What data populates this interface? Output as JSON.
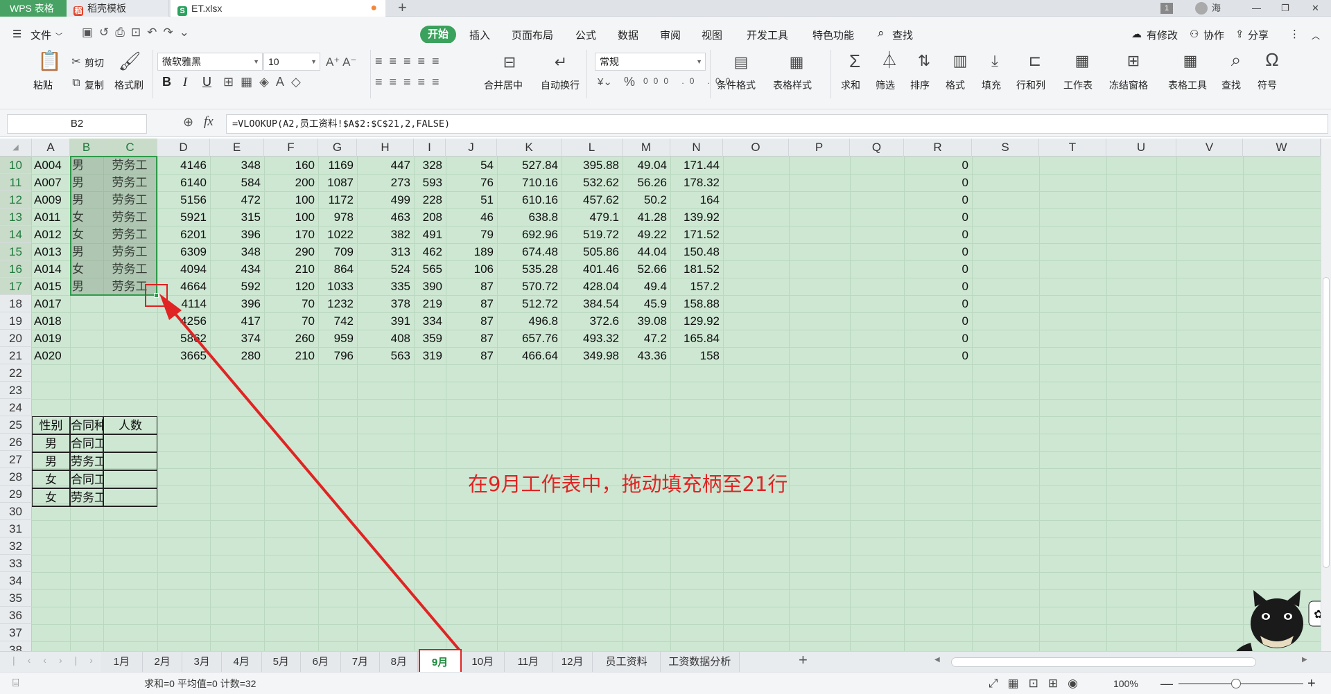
{
  "titlebar": {
    "app_tab": "WPS 表格",
    "docer_tab": "稻壳模板",
    "file_tab": "ET.xlsx",
    "new_tab": "+",
    "badge": "1",
    "user": "海"
  },
  "menu": {
    "file": "文件",
    "items": [
      "开始",
      "插入",
      "页面布局",
      "公式",
      "数据",
      "审阅",
      "视图",
      "开发工具",
      "特色功能"
    ],
    "search": "查找",
    "right": [
      "有修改",
      "协作",
      "分享"
    ]
  },
  "ribbon": {
    "paste": "粘贴",
    "cut": "剪切",
    "copy": "复制",
    "format_painter": "格式刷",
    "font_name": "微软雅黑",
    "font_size": "10",
    "bold": "B",
    "italic": "I",
    "underline": "U",
    "merge": "合并居中",
    "wrap": "自动换行",
    "number_format": "常规",
    "percent": "%",
    "cond_format": "条件格式",
    "table_style": "表格样式",
    "sum": "求和",
    "filter": "筛选",
    "sort": "排序",
    "format": "格式",
    "fill": "填充",
    "rowcol": "行和列",
    "sheet": "工作表",
    "freeze": "冻结窗格",
    "table_tools": "表格工具",
    "find": "查找",
    "symbol": "符号"
  },
  "formula_bar": {
    "name_box": "B2",
    "fx": "fx",
    "formula": "=VLOOKUP(A2,员工资料!$A$2:$C$21,2,FALSE)"
  },
  "grid": {
    "columns": [
      "A",
      "B",
      "C",
      "D",
      "E",
      "F",
      "G",
      "H",
      "I",
      "J",
      "K",
      "L",
      "M",
      "N",
      "O",
      "P",
      "Q",
      "R",
      "S",
      "T",
      "U",
      "V",
      "W"
    ],
    "row_numbers": [
      10,
      11,
      12,
      13,
      14,
      15,
      16,
      17,
      18,
      19,
      20,
      21,
      22,
      23,
      24,
      25,
      26,
      27,
      28,
      29,
      30,
      31,
      32,
      33,
      34,
      35,
      36,
      37,
      38
    ],
    "rows": [
      [
        "A004",
        "男",
        "劳务工",
        "4146",
        "348",
        "160",
        "1169",
        "447",
        "328",
        "54",
        "527.84",
        "395.88",
        "49.04",
        "171.44",
        "0"
      ],
      [
        "A007",
        "男",
        "劳务工",
        "6140",
        "584",
        "200",
        "1087",
        "273",
        "593",
        "76",
        "710.16",
        "532.62",
        "56.26",
        "178.32",
        "0"
      ],
      [
        "A009",
        "男",
        "劳务工",
        "5156",
        "472",
        "100",
        "1172",
        "499",
        "228",
        "51",
        "610.16",
        "457.62",
        "50.2",
        "164",
        "0"
      ],
      [
        "A011",
        "女",
        "劳务工",
        "5921",
        "315",
        "100",
        "978",
        "463",
        "208",
        "46",
        "638.8",
        "479.1",
        "41.28",
        "139.92",
        "0"
      ],
      [
        "A012",
        "女",
        "劳务工",
        "6201",
        "396",
        "170",
        "1022",
        "382",
        "491",
        "79",
        "692.96",
        "519.72",
        "49.22",
        "171.52",
        "0"
      ],
      [
        "A013",
        "男",
        "劳务工",
        "6309",
        "348",
        "290",
        "709",
        "313",
        "462",
        "189",
        "674.48",
        "505.86",
        "44.04",
        "150.48",
        "0"
      ],
      [
        "A014",
        "女",
        "劳务工",
        "4094",
        "434",
        "210",
        "864",
        "524",
        "565",
        "106",
        "535.28",
        "401.46",
        "52.66",
        "181.52",
        "0"
      ],
      [
        "A015",
        "男",
        "劳务工",
        "4664",
        "592",
        "120",
        "1033",
        "335",
        "390",
        "87",
        "570.72",
        "428.04",
        "49.4",
        "157.2",
        "0"
      ],
      [
        "A017",
        "",
        "",
        "4114",
        "396",
        "70",
        "1232",
        "378",
        "219",
        "87",
        "512.72",
        "384.54",
        "45.9",
        "158.88",
        "0"
      ],
      [
        "A018",
        "",
        "",
        "4256",
        "417",
        "70",
        "742",
        "391",
        "334",
        "87",
        "496.8",
        "372.6",
        "39.08",
        "129.92",
        "0"
      ],
      [
        "A019",
        "",
        "",
        "5862",
        "374",
        "260",
        "959",
        "408",
        "359",
        "87",
        "657.76",
        "493.32",
        "47.2",
        "165.84",
        "0"
      ],
      [
        "A020",
        "",
        "",
        "3665",
        "280",
        "210",
        "796",
        "563",
        "319",
        "87",
        "466.64",
        "349.98",
        "43.36",
        "158",
        "0"
      ]
    ],
    "summary_header": [
      "性别",
      "合同种类",
      "人数"
    ],
    "summary_rows": [
      [
        "男",
        "合同工"
      ],
      [
        "男",
        "劳务工"
      ],
      [
        "女",
        "合同工"
      ],
      [
        "女",
        "劳务工"
      ]
    ]
  },
  "annotation": "在9月工作表中，拖动填充柄至21行",
  "sheets": [
    "1月",
    "2月",
    "3月",
    "4月",
    "5月",
    "6月",
    "7月",
    "8月",
    "9月",
    "10月",
    "11月",
    "12月",
    "员工资料",
    "工资数据分析"
  ],
  "active_sheet": "9月",
  "status": {
    "summary": "求和=0  平均值=0  计数=32",
    "zoom": "100%"
  },
  "colors": {
    "accent": "#3aa25c",
    "grid_bg": "#cde7d2",
    "annotation": "#e02424"
  }
}
